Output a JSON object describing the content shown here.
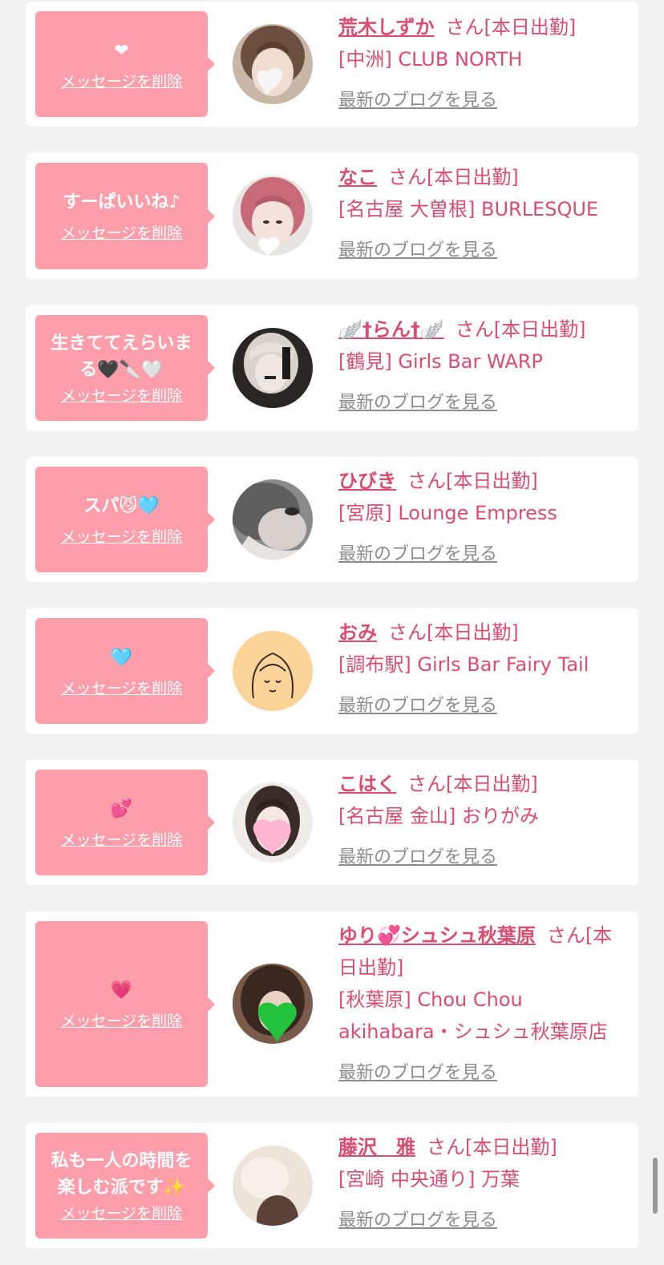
{
  "colors": {
    "accent": "#d94d70",
    "bubble": "#ff9eab",
    "link_gray": "#8c8c8c",
    "page_bg": "#f2f2f2"
  },
  "delete_label": "メッセージを削除",
  "blog_label": "最新のブログを見る",
  "san_suffix": "さん",
  "work_status": "[本日出勤]",
  "items": [
    {
      "message": "❤",
      "name": "荒木しずか",
      "shop": "[中洲] CLUB NORTH",
      "avatar": "photo-girl-white-heart"
    },
    {
      "message": "すーぱいいね♪",
      "name": "なこ",
      "shop": "[名古屋 大曽根] BURLESQUE",
      "avatar": "photo-pink-hair-girl"
    },
    {
      "message": "生きててえらいまる🖤🔪🤍",
      "name": "🪽†らん†🪽",
      "shop": "[鶴見] Girls Bar WARP",
      "avatar": "photo-blonde-girl"
    },
    {
      "message": "スパ😼🩵",
      "name": "ひびき",
      "shop": "[宮原] Lounge Empress",
      "avatar": "photo-girl-closeup"
    },
    {
      "message": "🩵",
      "name": "おみ",
      "shop": "[調布駅] Girls Bar Fairy Tail",
      "avatar": "illustration-girl"
    },
    {
      "message": "💕",
      "name": "こはく",
      "shop": "[名古屋 金山] おりがみ",
      "avatar": "photo-girl-pink-heart"
    },
    {
      "message": "💗",
      "name": "ゆり💞シュシュ秋葉原",
      "shop": "[秋葉原] Chou Chou akihabara・シュシュ秋葉原店",
      "avatar": "photo-girl-green-heart"
    },
    {
      "message": "私も一人の時間を楽しむ派です✨",
      "name": "藤沢　雅",
      "shop": "[宮崎 中央通り] 万葉",
      "avatar": "photo-beige-silhouette"
    }
  ]
}
